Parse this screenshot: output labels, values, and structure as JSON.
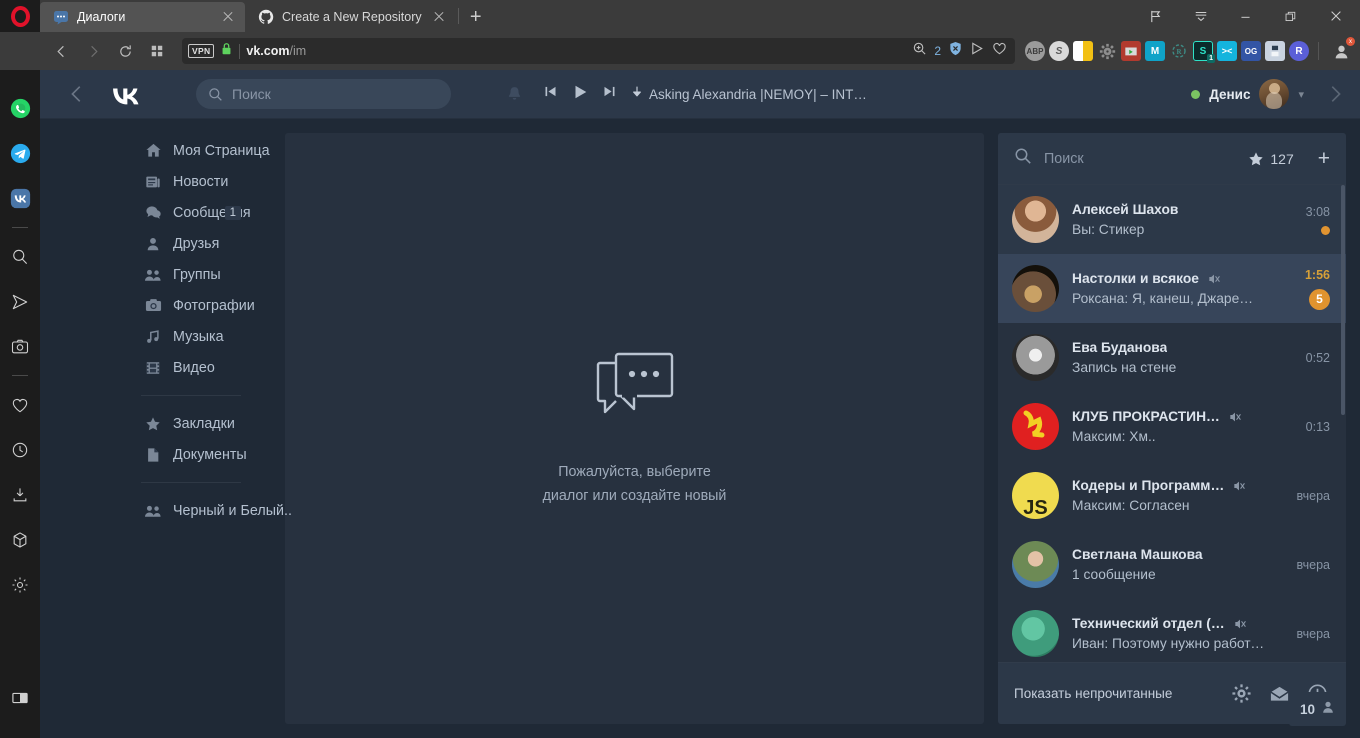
{
  "browser": {
    "tabs": [
      {
        "title": "Диалоги",
        "icon": "vk-messages-icon",
        "active": true
      },
      {
        "title": "Create a New Repository",
        "icon": "github-icon",
        "active": false
      }
    ],
    "new_tab_label": "+",
    "nav": {
      "back": "back-icon",
      "forward": "forward-icon",
      "reload": "reload-icon",
      "speeddial": "speed-dial-icon"
    },
    "address": {
      "vpn_label": "VPN",
      "lock": "lock-icon",
      "domain": "vk.com",
      "path": "/im",
      "blocked_count": "2"
    },
    "window_controls": {
      "pin": "pin-icon",
      "menu": "menu-icon",
      "minimize": "minimize-icon",
      "maximize": "maximize-icon",
      "close": "close-icon"
    },
    "extensions": [
      {
        "name": "adblock-plus-icon",
        "label": "ABP",
        "color": "#9b9b9b"
      },
      {
        "name": "skype-icon",
        "label": "S",
        "color": "#d9d9d9"
      },
      {
        "name": "honey-icon",
        "label": "",
        "color": "#f2c014"
      },
      {
        "name": "gear-extension-icon",
        "label": "",
        "color": "#8d8d8d"
      },
      {
        "name": "video-downloader-icon",
        "label": "",
        "color": "#b23a2e"
      },
      {
        "name": "mega-icon",
        "label": "M",
        "color": "#0fa3c8"
      },
      {
        "name": "refresh-extension-icon",
        "label": "",
        "color": "#3d8b85"
      },
      {
        "name": "savefrom-icon",
        "label": "S",
        "color": "#11a5a0",
        "badge": "1"
      },
      {
        "name": "clipper-icon",
        "label": "><",
        "color": "#14b4dd"
      },
      {
        "name": "og-icon",
        "label": "OG",
        "color": "#3355a5"
      },
      {
        "name": "save-page-icon",
        "label": "",
        "color": "#c9d3e0"
      },
      {
        "name": "roblox-icon",
        "label": "R",
        "color": "#5b5fd8"
      }
    ],
    "profile_badge": "x",
    "sidebar": [
      {
        "name": "whatsapp-icon"
      },
      {
        "name": "telegram-icon"
      },
      {
        "name": "vk-icon"
      },
      {
        "name": "divider"
      },
      {
        "name": "search-icon"
      },
      {
        "name": "messenger-send-icon"
      },
      {
        "name": "instagram-icon"
      },
      {
        "name": "divider"
      },
      {
        "name": "heart-icon"
      },
      {
        "name": "history-icon"
      },
      {
        "name": "downloads-icon"
      },
      {
        "name": "extensions-icon"
      },
      {
        "name": "settings-icon"
      },
      {
        "name": "spacer"
      },
      {
        "name": "panel-toggle-icon"
      }
    ]
  },
  "vk": {
    "header": {
      "back_arrow": "chevron-left-icon",
      "forward_arrow": "chevron-right-icon",
      "logo": "vk-logo",
      "search_placeholder": "Поиск",
      "notifications": "bell-icon",
      "player": {
        "prev": "prev-track-icon",
        "play": "play-icon",
        "next": "next-track-icon",
        "download": "download-icon",
        "track": "Asking Alexandria |NEMOY| – INT…"
      },
      "user": {
        "status": "online",
        "name": "Денис",
        "avatar": "user-avatar",
        "caret": "chevron-down-icon"
      }
    },
    "menu": [
      {
        "label": "Моя Страница",
        "icon": "home-icon",
        "count": ""
      },
      {
        "label": "Новости",
        "icon": "news-icon",
        "count": ""
      },
      {
        "label": "Сообщения",
        "icon": "messages-icon",
        "count": "1"
      },
      {
        "label": "Друзья",
        "icon": "friends-icon",
        "count": ""
      },
      {
        "label": "Группы",
        "icon": "groups-icon",
        "count": ""
      },
      {
        "label": "Фотографии",
        "icon": "photos-icon",
        "count": ""
      },
      {
        "label": "Музыка",
        "icon": "music-icon",
        "count": ""
      },
      {
        "label": "Видео",
        "icon": "video-icon",
        "count": ""
      }
    ],
    "menu2": [
      {
        "label": "Закладки",
        "icon": "star-icon",
        "count": ""
      },
      {
        "label": "Документы",
        "icon": "documents-icon",
        "count": ""
      }
    ],
    "menu3": [
      {
        "label": "Черный и Белый..",
        "icon": "groups-icon",
        "count": ""
      }
    ],
    "empty_state": {
      "icon": "chat-bubbles-icon",
      "line1": "Пожалуйста, выберите",
      "line2": "диалог или создайте новый"
    },
    "chatlist": {
      "search_placeholder": "Поиск",
      "favorites_icon": "star-icon",
      "favorites_count": "127",
      "compose_icon": "plus-icon",
      "rows": [
        {
          "name": "Алексей Шахов",
          "preview": "Вы: Стикер",
          "time": "3:08",
          "muted": false,
          "state": "unread",
          "badge": "",
          "dot": true,
          "avatar_colors": [
            "#caa07e",
            "#8a5b3c"
          ]
        },
        {
          "name": "Настолки и всякое",
          "preview": "Роксана: Я, канеш, Джаре…",
          "time": "1:56",
          "muted": true,
          "state": "selected",
          "badge": "5",
          "dot": false,
          "avatar_colors": [
            "#6a4f3a",
            "#1c1409"
          ]
        },
        {
          "name": "Ева Буданова",
          "preview": "Запись на стене",
          "time": "0:52",
          "muted": false,
          "state": "read",
          "badge": "",
          "dot": false,
          "avatar_colors": [
            "#d9d9d9",
            "#4a4a4a"
          ]
        },
        {
          "name": "КЛУБ ПРОКРАСТИН…",
          "preview": "Максим: Хм..",
          "time": "0:13",
          "muted": true,
          "state": "read",
          "badge": "",
          "dot": false,
          "avatar_colors": [
            "#e02020",
            "#f2d024"
          ]
        },
        {
          "name": "Кодеры и Программ…",
          "preview": "Максим: Согласен",
          "time": "вчера",
          "muted": true,
          "state": "read",
          "badge": "",
          "dot": false,
          "avatar_colors": [
            "#f0db4f",
            "#2b2b1a"
          ]
        },
        {
          "name": "Светлана Машкова",
          "preview": "1 сообщение",
          "time": "вчера",
          "muted": false,
          "state": "read",
          "badge": "",
          "dot": false,
          "avatar_colors": [
            "#89a86a",
            "#3f6b8a"
          ]
        },
        {
          "name": "Технический отдел (…",
          "preview": "Иван: Поэтому нужно работать по пр…",
          "time": "вчера",
          "muted": true,
          "state": "read",
          "badge": "",
          "dot": false,
          "avatar_colors": [
            "#4fae8e",
            "#2e7d62"
          ]
        }
      ],
      "footer": {
        "show_unread": "Показать непрочитанные",
        "settings_icon": "gear-icon",
        "mail_icon": "envelope-icon",
        "info_icon": "info-icon"
      }
    },
    "online_widget": {
      "count": "10",
      "icon": "person-icon"
    },
    "colors": {
      "page_bg": "#1f2936",
      "panel_bg": "#27313f",
      "header_bg": "#2c3849",
      "selected_row": "#37455a",
      "unread_row": "#2c3848",
      "accent_orange": "#e0932e",
      "accent_yellow": "#d6a038",
      "online_green": "#7bc362",
      "text_primary": "#dde4ed",
      "text_secondary": "#8794a5"
    }
  }
}
